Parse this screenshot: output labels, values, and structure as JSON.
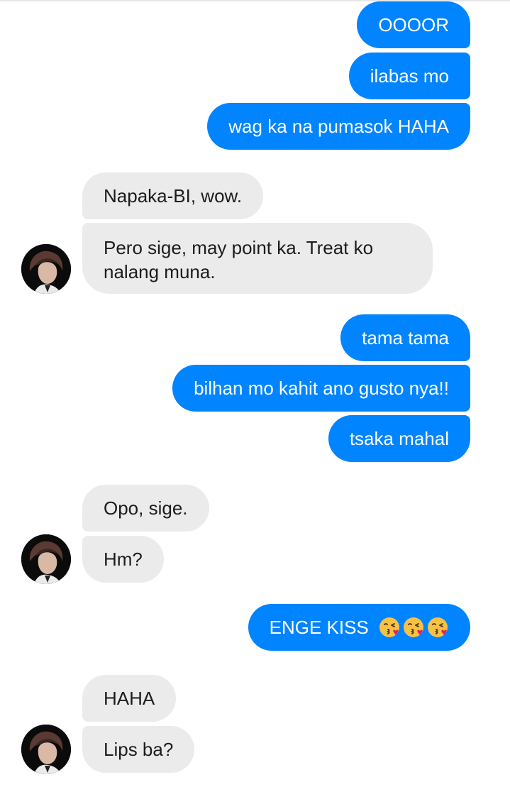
{
  "conversation": {
    "messages": [
      {
        "side": "out",
        "text": "OOOOR"
      },
      {
        "side": "out",
        "text": "ilabas mo"
      },
      {
        "side": "out",
        "text": "wag ka na pumasok HAHA"
      },
      {
        "side": "in",
        "text": "Napaka-BI, wow."
      },
      {
        "side": "in",
        "text": "Pero sige, may point ka. Treat ko nalang muna."
      },
      {
        "side": "out",
        "text": "tama tama"
      },
      {
        "side": "out",
        "text": "bilhan mo kahit ano gusto nya!!"
      },
      {
        "side": "out",
        "text": "tsaka mahal"
      },
      {
        "side": "in",
        "text": "Opo, sige."
      },
      {
        "side": "in",
        "text": "Hm?"
      },
      {
        "side": "out",
        "text": "ENGE KISS",
        "emoji": [
          "face-blowing-kiss-icon",
          "face-blowing-kiss-icon",
          "face-blowing-kiss-icon"
        ]
      },
      {
        "side": "in",
        "text": "HAHA"
      },
      {
        "side": "in",
        "text": "Lips ba?"
      }
    ]
  },
  "colors": {
    "outgoing_bubble": "#0084ff",
    "incoming_bubble": "#ebebeb",
    "outgoing_text": "#ffffff",
    "incoming_text": "#1c1c1c"
  }
}
